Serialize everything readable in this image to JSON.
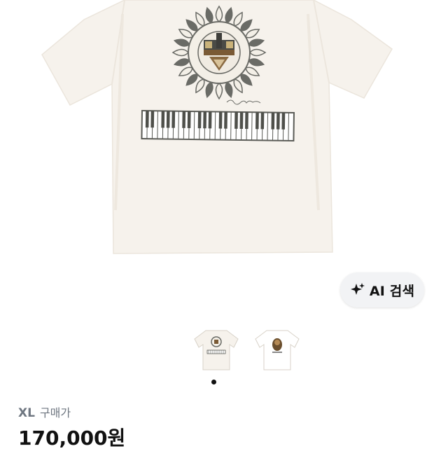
{
  "ai_search": {
    "label": "AI 검색",
    "icon": "sparkle-icon"
  },
  "gallery": {
    "thumbnails": [
      {
        "icon": "shirt-thumbnail-keyboard"
      },
      {
        "icon": "shirt-thumbnail-portrait"
      }
    ],
    "indicator_active": 1
  },
  "product": {
    "option_size": "XL",
    "option_label": "구매가",
    "price": "170,000원"
  },
  "colors": {
    "shirt": "#f5f1ea",
    "sun_gray": "#6a6b66",
    "accent_brown": "#7a5a35",
    "text_muted": "#6e7680"
  }
}
